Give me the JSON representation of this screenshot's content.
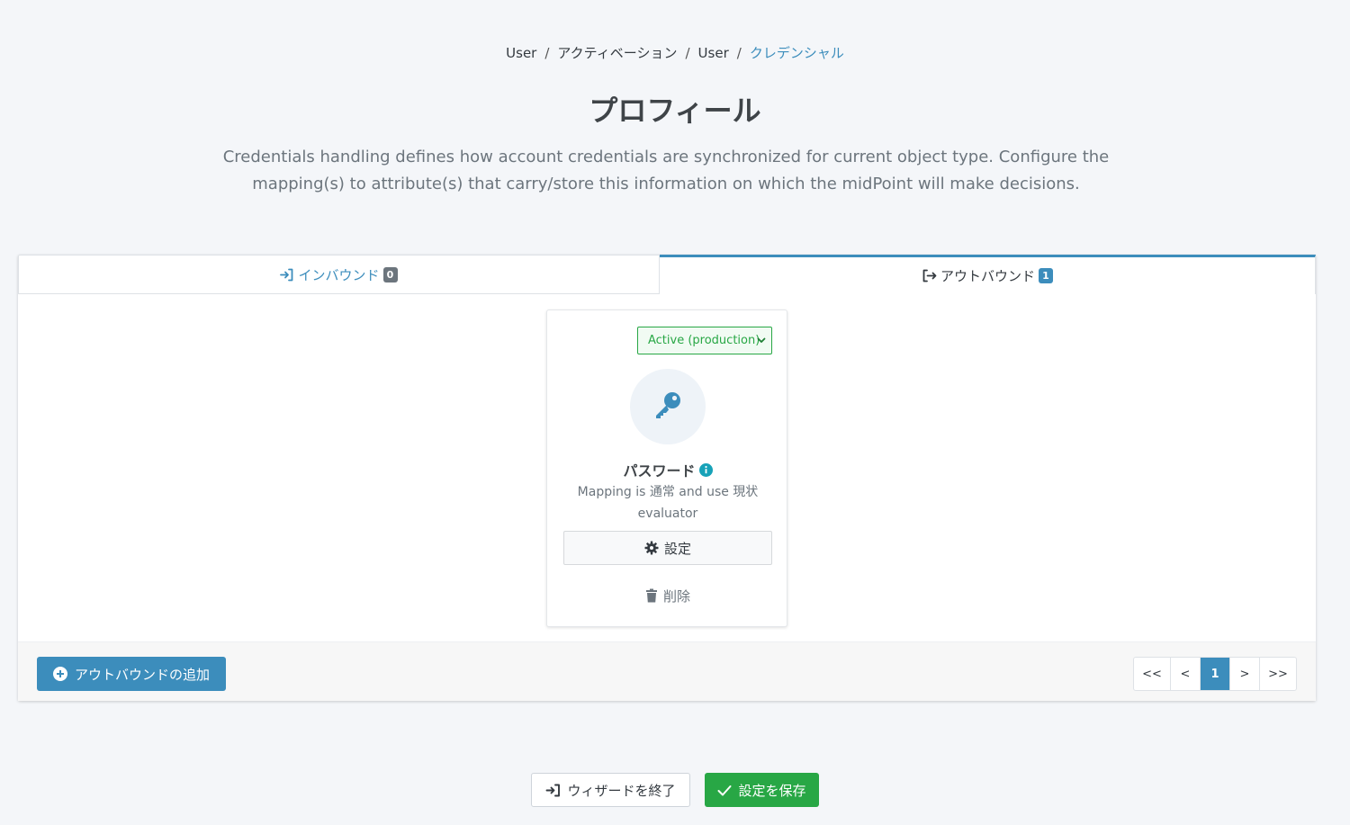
{
  "breadcrumb": {
    "items": [
      "User",
      "アクティベーション",
      "User"
    ],
    "current": "クレデンシャル"
  },
  "header": {
    "title": "プロフィール",
    "description": "Credentials handling defines how account credentials are synchronized for current object type. Configure the mapping(s) to attribute(s) that carry/store this information on which the midPoint will make decisions."
  },
  "tabs": [
    {
      "label": "インバウンド",
      "count": "0",
      "icon": "sign-in-icon"
    },
    {
      "label": "アウトバウンド",
      "count": "1",
      "icon": "sign-out-icon"
    }
  ],
  "card": {
    "lifecycle_state": "Active (production)",
    "icon": "key-icon",
    "title": "パスワード",
    "description": "Mapping is 通常 and use 現状 evaluator",
    "configure_label": "設定",
    "delete_label": "削除"
  },
  "footer": {
    "add_label": "アウトバウンドの追加",
    "pager": [
      "<<",
      "<",
      "1",
      ">",
      ">>"
    ],
    "current_page": "1"
  },
  "actions": {
    "exit_label": "ウィザードを終了",
    "save_label": "設定を保存"
  },
  "colors": {
    "primary": "#3c8dbc",
    "success": "#28a745",
    "background": "#f4f6f9"
  }
}
